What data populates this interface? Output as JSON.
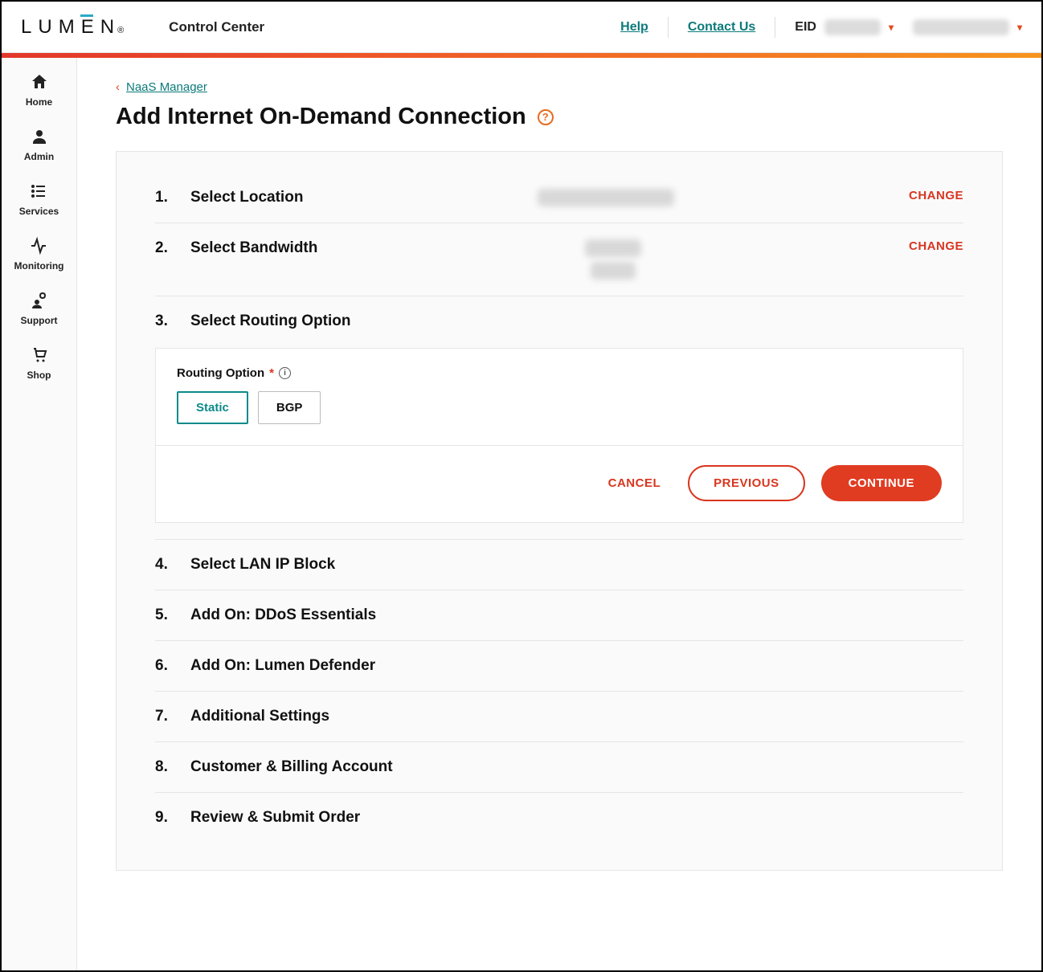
{
  "header": {
    "logo_text": "LUMEN",
    "app_title": "Control Center",
    "help_link": "Help",
    "contact_link": "Contact Us",
    "eid_label": "EID"
  },
  "sidebar": {
    "items": [
      {
        "label": "Home"
      },
      {
        "label": "Admin"
      },
      {
        "label": "Services"
      },
      {
        "label": "Monitoring"
      },
      {
        "label": "Support"
      },
      {
        "label": "Shop"
      }
    ]
  },
  "breadcrumb": {
    "parent_label": "NaaS Manager"
  },
  "page": {
    "title": "Add Internet On-Demand Connection"
  },
  "steps": {
    "s1": {
      "num": "1.",
      "title": "Select Location",
      "change": "CHANGE"
    },
    "s2": {
      "num": "2.",
      "title": "Select Bandwidth",
      "change": "CHANGE"
    },
    "s3": {
      "num": "3.",
      "title": "Select Routing Option",
      "field_label": "Routing Option",
      "option_static": "Static",
      "option_bgp": "BGP",
      "cancel": "CANCEL",
      "previous": "PREVIOUS",
      "continue": "CONTINUE"
    },
    "s4": {
      "num": "4.",
      "title": "Select LAN IP Block"
    },
    "s5": {
      "num": "5.",
      "title": "Add On: DDoS Essentials"
    },
    "s6": {
      "num": "6.",
      "title": "Add On: Lumen Defender"
    },
    "s7": {
      "num": "7.",
      "title": "Additional Settings"
    },
    "s8": {
      "num": "8.",
      "title": "Customer & Billing Account"
    },
    "s9": {
      "num": "9.",
      "title": "Review & Submit Order"
    }
  }
}
